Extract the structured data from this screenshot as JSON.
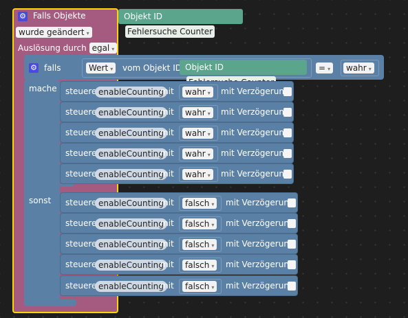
{
  "event": {
    "title": "Falls Objekte",
    "object_label": "Objekt ID",
    "object_value": "Fehlersuche Counter",
    "trigger": "wurde geändert",
    "source_label": "Auslösung durch",
    "source_value": "egal"
  },
  "if_block": {
    "if_label": "falls",
    "then_label": "mache",
    "else_label": "sonst",
    "value_select": "Wert",
    "of_object_label": "vom Objekt ID",
    "object_label": "Objekt ID",
    "object_value": "Fehlersuche Counter",
    "operator": "=",
    "compare_value": "wahr"
  },
  "set_rows_then": [
    {
      "prefix": "steuere",
      "var": "enableCounting",
      "with": "mit",
      "value": "wahr",
      "delay": "mit Verzögerung"
    },
    {
      "prefix": "steuere",
      "var": "enableCounting",
      "with": "mit",
      "value": "wahr",
      "delay": "mit Verzögerung"
    },
    {
      "prefix": "steuere",
      "var": "enableCounting",
      "with": "mit",
      "value": "wahr",
      "delay": "mit Verzögerung"
    },
    {
      "prefix": "steuere",
      "var": "enableCounting",
      "with": "mit",
      "value": "wahr",
      "delay": "mit Verzögerung"
    },
    {
      "prefix": "steuere",
      "var": "enableCounting",
      "with": "mit",
      "value": "wahr",
      "delay": "mit Verzögerung"
    }
  ],
  "set_rows_else": [
    {
      "prefix": "steuere",
      "var": "enableCounting",
      "with": "mit",
      "value": "falsch",
      "delay": "mit Verzögerung"
    },
    {
      "prefix": "steuere",
      "var": "enableCounting",
      "with": "mit",
      "value": "falsch",
      "delay": "mit Verzögerung"
    },
    {
      "prefix": "steuere",
      "var": "enableCounting",
      "with": "mit",
      "value": "falsch",
      "delay": "mit Verzögerung"
    },
    {
      "prefix": "steuere",
      "var": "enableCounting",
      "with": "mit",
      "value": "falsch",
      "delay": "mit Verzögerung"
    },
    {
      "prefix": "steuere",
      "var": "enableCounting",
      "with": "mit",
      "value": "falsch",
      "delay": "mit Verzögerung"
    }
  ],
  "colors": {
    "background": "#1e1e1e",
    "event_block": "#a55b80",
    "selection_outline": "#ffd700",
    "logic_block": "#5b80a5",
    "object_block": "#5ba58c"
  },
  "icons": {
    "gear": "gear-icon",
    "dropdown": "chevron-down-icon"
  }
}
